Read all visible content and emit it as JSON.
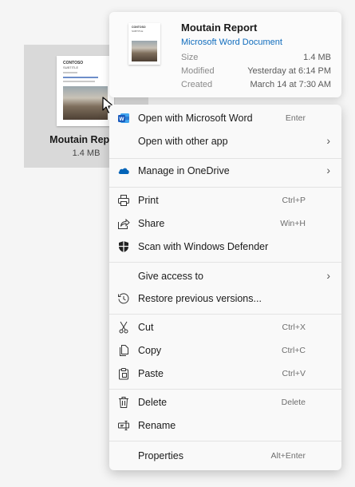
{
  "file": {
    "name": "Moutain Report",
    "size": "1.4 MB",
    "thumb_brand": "CONTOSO",
    "thumb_subtitle": "SUBTITLE"
  },
  "info_card": {
    "title": "Moutain Report",
    "type": "Microsoft Word Document",
    "rows": [
      {
        "key": "Size",
        "value": "1.4 MB"
      },
      {
        "key": "Modified",
        "value": "Yesterday at 6:14 PM"
      },
      {
        "key": "Created",
        "value": "March 14 at 7:30 AM"
      }
    ]
  },
  "menu": {
    "items": [
      {
        "label": "Open with Microsoft Word",
        "shortcut": "Enter",
        "icon": "word-icon"
      },
      {
        "label": "Open with other app",
        "icon": "",
        "submenu": true
      },
      {
        "label": "Manage in OneDrive",
        "icon": "onedrive-icon",
        "submenu": true
      },
      {
        "label": "Print",
        "shortcut": "Ctrl+P",
        "icon": "printer-icon"
      },
      {
        "label": "Share",
        "shortcut": "Win+H",
        "icon": "share-icon"
      },
      {
        "label": "Scan with Windows Defender",
        "icon": "shield-icon"
      },
      {
        "label": "Give access to",
        "icon": "",
        "submenu": true
      },
      {
        "label": "Restore previous versions...",
        "icon": "history-icon"
      },
      {
        "label": "Cut",
        "shortcut": "Ctrl+X",
        "icon": "scissors-icon"
      },
      {
        "label": "Copy",
        "shortcut": "Ctrl+C",
        "icon": "copy-icon"
      },
      {
        "label": "Paste",
        "shortcut": "Ctrl+V",
        "icon": "paste-icon"
      },
      {
        "label": "Delete",
        "shortcut": "Delete",
        "icon": "trash-icon"
      },
      {
        "label": "Rename",
        "icon": "rename-icon"
      },
      {
        "label": "Properties",
        "shortcut": "Alt+Enter",
        "icon": ""
      }
    ]
  },
  "colors": {
    "accent": "#0f6cbd",
    "word_blue": "#185abd",
    "onedrive_blue": "#0364b8"
  }
}
